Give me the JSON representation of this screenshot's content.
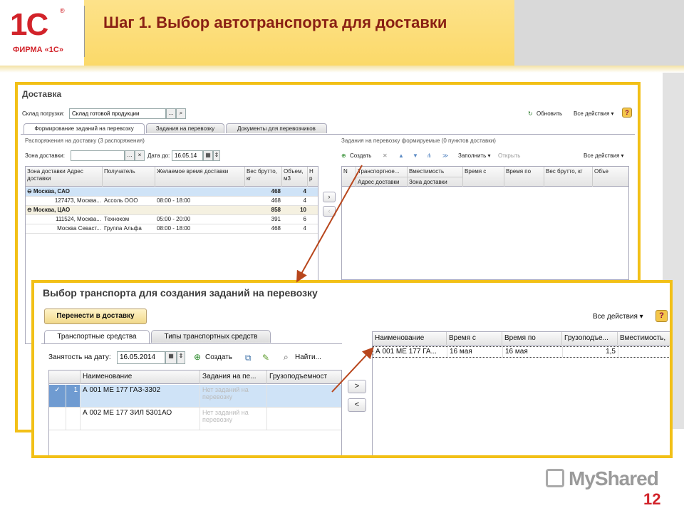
{
  "slide": {
    "title": "Шаг 1. Выбор автотранспорта для доставки",
    "logo_text": "1С",
    "logo_reg": "®",
    "logo_sub": "ФИРМА «1С»",
    "page_number": "12",
    "brand": "MyShared"
  },
  "colors": {
    "accent": "#f2c017",
    "brand_red": "#d2232a",
    "title": "#8a2014",
    "selected_row": "#cfe3f7"
  },
  "window": {
    "title": "Доставка",
    "warehouse_label": "Склад погрузки:",
    "warehouse_value": "Склад готовой продукции",
    "refresh": "Обновить",
    "all_actions": "Все действия ▾",
    "help": "?",
    "tabs": [
      "Формирование заданий на перевозку",
      "Задания на перевозку",
      "Документы для перевозчиков"
    ],
    "left_group": "Распоряжения на доставку (3 распоряжения)",
    "zone_label": "Зона доставки:",
    "date_label": "Дата до:",
    "date_value": "16.05.14",
    "left_columns": [
      "Зона доставки\nАдрес доставки",
      "Получатель",
      "Желаемое время доставки",
      "Вес брутто, кг",
      "Объем, м3",
      "Н р"
    ],
    "left_rows": [
      {
        "zone": "⊖ Москва, САО",
        "recipient": "",
        "time": "",
        "weight": "468",
        "volume": "4",
        "type": "selected"
      },
      {
        "zone": "127473, Москва...",
        "recipient": "Ассоль ООО",
        "time": "08:00 - 18:00",
        "weight": "468",
        "volume": "4",
        "type": ""
      },
      {
        "zone": "⊖ Москва, ЦАО",
        "recipient": "",
        "time": "",
        "weight": "858",
        "volume": "10",
        "type": "group"
      },
      {
        "zone": "111524, Москва...",
        "recipient": "Техноком",
        "time": "05:00 - 20:00",
        "weight": "391",
        "volume": "6",
        "type": ""
      },
      {
        "zone": "Москва Севаст...",
        "recipient": "Группа Альфа",
        "time": "08:00 - 18:00",
        "weight": "468",
        "volume": "4",
        "type": ""
      }
    ],
    "right_group": "Задания на перевозку формируемые (0 пунктов доставки)",
    "create": "Создать",
    "fill": "Заполнить ▾",
    "open": "Открыть",
    "right_columns": [
      "N",
      "Транспортное...",
      "Вместимость",
      "Время с",
      "Время по",
      "Вес брутто, кг",
      "Объе"
    ],
    "right_sub_columns": [
      "Адрес доставки",
      "Зона доставки"
    ]
  },
  "popup": {
    "title": "Выбор транспорта для создания заданий на перевозку",
    "transfer_button": "Перенести в доставку",
    "all_actions": "Все действия ▾",
    "help": "?",
    "tabs": [
      "Транспортные средства",
      "Типы транспортных средств"
    ],
    "busy_label": "Занятость на дату:",
    "busy_date": "16.05.2014",
    "create": "Создать",
    "find": "Найти...",
    "left_columns": [
      "Наименование",
      "Задания на пе...",
      "Грузоподъемност"
    ],
    "left_rows": [
      {
        "check": "✓",
        "num": "1",
        "name": "А 001 МЕ 177 ГАЗ-3302",
        "tasks": "Нет заданий на перевозку",
        "selected": true
      },
      {
        "check": "",
        "num": "",
        "name": "А 002 МЕ 177 ЗИЛ 5301АО",
        "tasks": "Нет заданий на перевозку",
        "selected": false
      }
    ],
    "right_columns": [
      "Наименование",
      "Время с",
      "Время по",
      "Грузоподъе...",
      "Вместимость,"
    ],
    "right_rows": [
      {
        "name": "А 001 МЕ 177 ГА...",
        "from": "16 мая",
        "to": "16 мая",
        "capacity": "1,5",
        "volume": ""
      }
    ],
    "nav_right": ">",
    "nav_left": "<"
  }
}
